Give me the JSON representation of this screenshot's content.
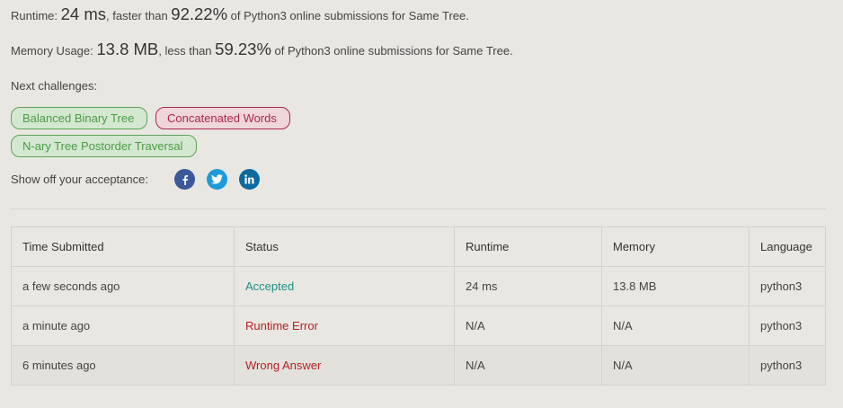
{
  "runtime_line": {
    "prefix": "Runtime: ",
    "value": "24 ms",
    "middle": ", faster than ",
    "percent": "92.22%",
    "suffix": " of Python3 online submissions for Same Tree."
  },
  "memory_line": {
    "prefix": "Memory Usage: ",
    "value": "13.8 MB",
    "middle": ", less than ",
    "percent": "59.23%",
    "suffix": " of Python3 online submissions for Same Tree."
  },
  "next_challenges": {
    "label": "Next challenges:",
    "items": [
      {
        "label": "Balanced Binary Tree",
        "difficulty": "easy"
      },
      {
        "label": "Concatenated Words",
        "difficulty": "hard"
      },
      {
        "label": "N-ary Tree Postorder Traversal",
        "difficulty": "easy"
      }
    ]
  },
  "share": {
    "label": "Show off your acceptance:",
    "icons": [
      "facebook-icon",
      "twitter-icon",
      "linkedin-icon"
    ]
  },
  "colors": {
    "accepted": "#1f8f85",
    "error": "#b22222",
    "easy": "#4a9d45",
    "hard": "#a8284f",
    "facebook": "#3b5998",
    "twitter": "#1d9bd8",
    "linkedin": "#0d6aa0"
  },
  "submissions": {
    "headers": [
      "Time Submitted",
      "Status",
      "Runtime",
      "Memory",
      "Language"
    ],
    "rows": [
      {
        "time": "a few seconds ago",
        "status": "Accepted",
        "runtime": "24 ms",
        "memory": "13.8 MB",
        "language": "python3"
      },
      {
        "time": "a minute ago",
        "status": "Runtime Error",
        "runtime": "N/A",
        "memory": "N/A",
        "language": "python3"
      },
      {
        "time": "6 minutes ago",
        "status": "Wrong Answer",
        "runtime": "N/A",
        "memory": "N/A",
        "language": "python3"
      }
    ]
  }
}
